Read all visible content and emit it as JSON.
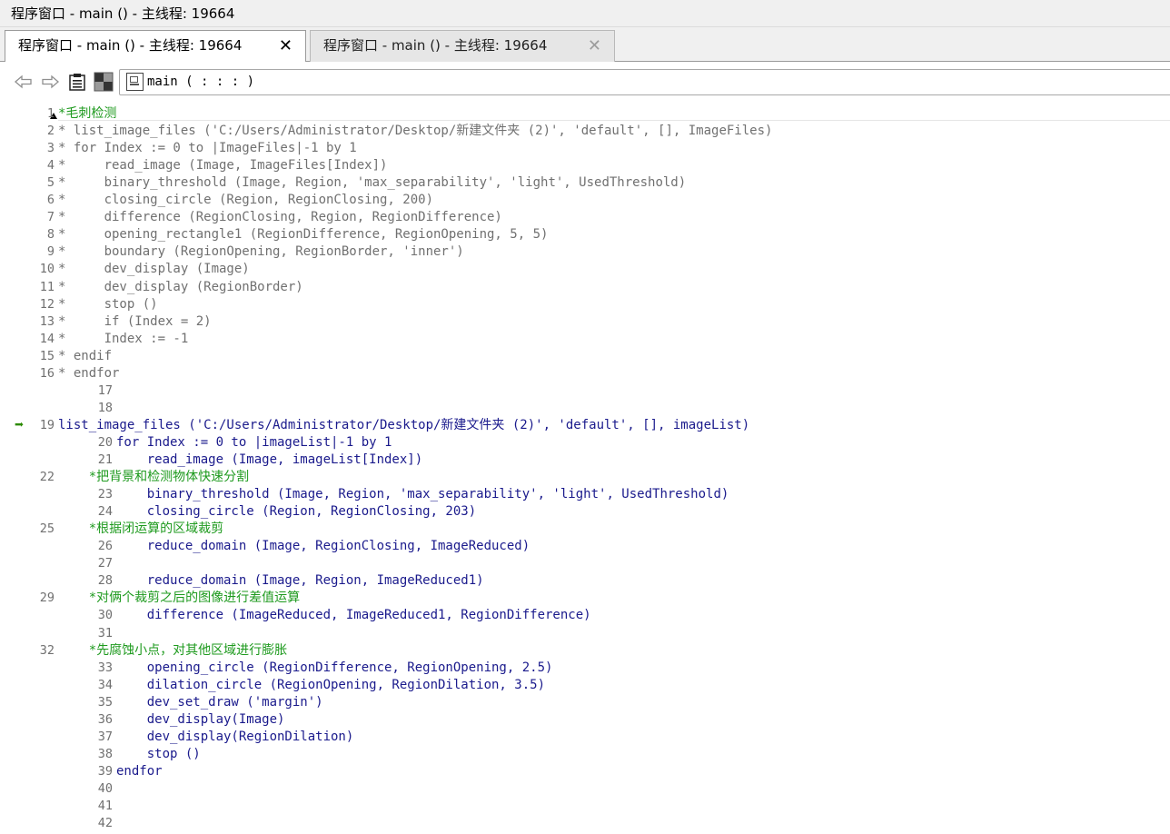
{
  "window": {
    "title": "程序窗口 - main () - 主线程: 19664"
  },
  "tabs": [
    {
      "label": "程序窗口 - main () - 主线程: 19664",
      "active": true,
      "close": "✕"
    },
    {
      "label": "程序窗口 - main () - 主线程: 19664",
      "active": false,
      "close": "✕"
    }
  ],
  "toolbar": {
    "back_icon": "arrow-left-outline-icon",
    "forward_icon": "arrow-right-outline-icon",
    "clipboard_icon": "clipboard-icon",
    "grid_icon": "grid-icon",
    "procedure_label": "main ( : : : )"
  },
  "editor": {
    "current_line": 19,
    "lines": [
      {
        "n": "1",
        "type": "greencomment",
        "text": "*毛刺检测"
      },
      {
        "n": "2",
        "type": "comment",
        "text": "* list_image_files ('C:/Users/Administrator/Desktop/新建文件夹 (2)', 'default', [], ImageFiles)"
      },
      {
        "n": "3",
        "type": "comment",
        "text": "* for Index := 0 to |ImageFiles|-1 by 1"
      },
      {
        "n": "4",
        "type": "comment",
        "text": "*     read_image (Image, ImageFiles[Index])"
      },
      {
        "n": "5",
        "type": "comment",
        "text": "*     binary_threshold (Image, Region, 'max_separability', 'light', UsedThreshold)"
      },
      {
        "n": "6",
        "type": "comment",
        "text": "*     closing_circle (Region, RegionClosing, 200)"
      },
      {
        "n": "7",
        "type": "comment",
        "text": "*     difference (RegionClosing, Region, RegionDifference)"
      },
      {
        "n": "8",
        "type": "comment",
        "text": "*     opening_rectangle1 (RegionDifference, RegionOpening, 5, 5)"
      },
      {
        "n": "9",
        "type": "comment",
        "text": "*     boundary (RegionOpening, RegionBorder, 'inner')"
      },
      {
        "n": "10",
        "type": "comment",
        "text": "*     dev_display (Image)"
      },
      {
        "n": "11",
        "type": "comment",
        "text": "*     dev_display (RegionBorder)"
      },
      {
        "n": "12",
        "type": "comment",
        "text": "*     stop ()"
      },
      {
        "n": "13",
        "type": "comment",
        "text": "*     if (Index = 2)"
      },
      {
        "n": "14",
        "type": "comment",
        "text": "*     Index := -1"
      },
      {
        "n": "15",
        "type": "comment",
        "text": "* endif"
      },
      {
        "n": "16",
        "type": "comment",
        "text": "* endfor"
      },
      {
        "n": "17",
        "type": "code",
        "text": ""
      },
      {
        "n": "18",
        "type": "code",
        "text": ""
      },
      {
        "n": "19",
        "type": "active",
        "text": "list_image_files ('C:/Users/Administrator/Desktop/新建文件夹 (2)', 'default', [], imageList)"
      },
      {
        "n": "20",
        "type": "code",
        "text": "for Index := 0 to |imageList|-1 by 1"
      },
      {
        "n": "21",
        "type": "code",
        "text": "    read_image (Image, imageList[Index])"
      },
      {
        "n": "22",
        "type": "greencomment",
        "text": "    *把背景和检测物体快速分割"
      },
      {
        "n": "23",
        "type": "code",
        "text": "    binary_threshold (Image, Region, 'max_separability', 'light', UsedThreshold)"
      },
      {
        "n": "24",
        "type": "code",
        "text": "    closing_circle (Region, RegionClosing, 203)"
      },
      {
        "n": "25",
        "type": "greencomment",
        "text": "    *根据闭运算的区域裁剪"
      },
      {
        "n": "26",
        "type": "code",
        "text": "    reduce_domain (Image, RegionClosing, ImageReduced)"
      },
      {
        "n": "27",
        "type": "code",
        "text": ""
      },
      {
        "n": "28",
        "type": "code",
        "text": "    reduce_domain (Image, Region, ImageReduced1)"
      },
      {
        "n": "29",
        "type": "greencomment",
        "text": "    *对俩个裁剪之后的图像进行差值运算"
      },
      {
        "n": "30",
        "type": "code",
        "text": "    difference (ImageReduced, ImageReduced1, RegionDifference)"
      },
      {
        "n": "31",
        "type": "code",
        "text": ""
      },
      {
        "n": "32",
        "type": "greencomment",
        "text": "    *先腐蚀小点，对其他区域进行膨胀"
      },
      {
        "n": "33",
        "type": "code",
        "text": "    opening_circle (RegionDifference, RegionOpening, 2.5)"
      },
      {
        "n": "34",
        "type": "code",
        "text": "    dilation_circle (RegionOpening, RegionDilation, 3.5)"
      },
      {
        "n": "35",
        "type": "code",
        "text": "    dev_set_draw ('margin')"
      },
      {
        "n": "36",
        "type": "code",
        "text": "    dev_display(Image)"
      },
      {
        "n": "37",
        "type": "code",
        "text": "    dev_display(RegionDilation)"
      },
      {
        "n": "38",
        "type": "code",
        "text": "    stop ()"
      },
      {
        "n": "39",
        "type": "code",
        "text": "endfor"
      },
      {
        "n": "40",
        "type": "code",
        "text": ""
      },
      {
        "n": "41",
        "type": "code",
        "text": ""
      },
      {
        "n": "42",
        "type": "code",
        "text": ""
      },
      {
        "n": "43",
        "type": "code",
        "text": ""
      }
    ]
  },
  "colors": {
    "code": "#1a1a8c",
    "comment": "#707070",
    "green_comment": "#1e9a1e",
    "pc_arrow": "#2b8a00"
  }
}
